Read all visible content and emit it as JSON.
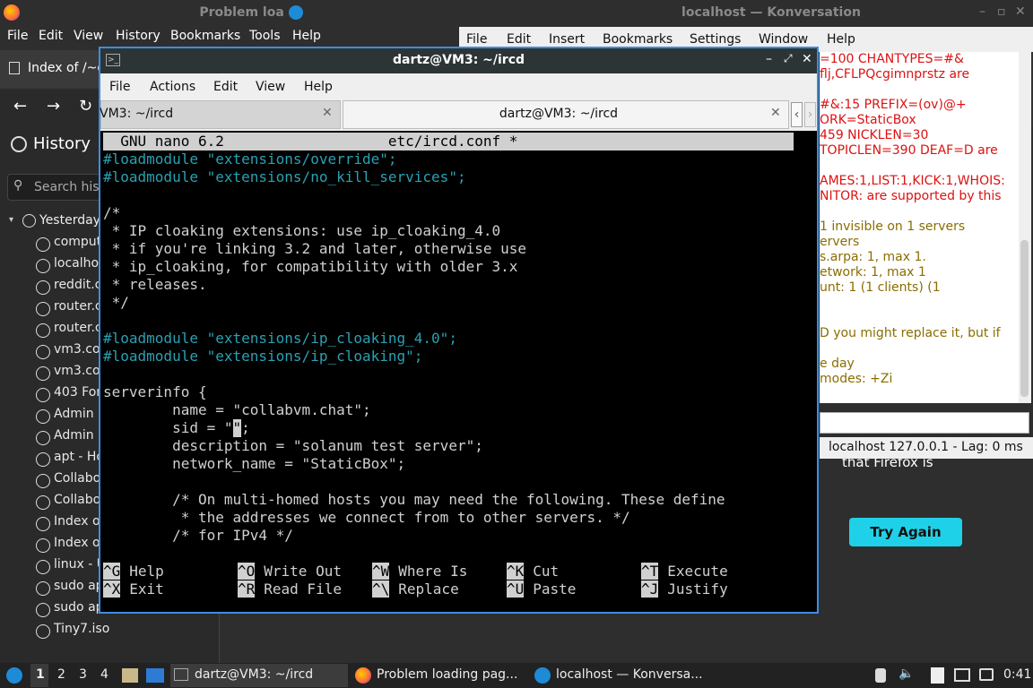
{
  "firefox": {
    "title": "Problem loa",
    "menu": [
      "File",
      "Edit",
      "View",
      "History",
      "Bookmarks",
      "Tools",
      "Help"
    ],
    "tab_label": "Index of /~d",
    "history_title": "History",
    "search_placeholder": "Search hist",
    "history_group": "Yesterday",
    "history_items": [
      "comput",
      "localhos",
      "reddit.c",
      "router.c",
      "router.c",
      "vm3.co",
      "vm3.co",
      "403 For",
      "Admin P",
      "Admin P",
      "apt - Ho",
      "Collabo",
      "Collabo",
      "Index of",
      "Index of",
      "linux - U",
      "sudo ap",
      "sudo ap",
      "Tiny7.iso"
    ],
    "content_text": "that Firefox is",
    "try_again": "Try Again"
  },
  "konversation": {
    "title": "localhost — Konversation",
    "menu": [
      "File",
      "Edit",
      "Insert",
      "Bookmarks",
      "Settings",
      "Window",
      "Help"
    ],
    "lines": [
      {
        "text": "=100 CHANTYPES=#&",
        "color": "#d11"
      },
      {
        "text": "flj,CFLPQcgimnprstz are",
        "color": "#d11"
      },
      {
        "text": "",
        "color": "#d11"
      },
      {
        "text": "#&:15 PREFIX=(ov)@+",
        "color": "#d11"
      },
      {
        "text": "ORK=StaticBox",
        "color": "#d11"
      },
      {
        "text": " 459 NICKLEN=30",
        "color": "#d11"
      },
      {
        "text": "TOPICLEN=390 DEAF=D are",
        "color": "#d11"
      },
      {
        "text": "",
        "color": "#d11"
      },
      {
        "text": "AMES:1,LIST:1,KICK:1,WHOIS:",
        "color": "#d11"
      },
      {
        "text": "NITOR: are supported by this",
        "color": "#d11"
      },
      {
        "text": "",
        "color": "#d11"
      },
      {
        "text": "1 invisible on 1 servers",
        "color": "#8a6d00"
      },
      {
        "text": "ervers",
        "color": "#8a6d00"
      },
      {
        "text": "s.arpa: 1, max 1.",
        "color": "#8a6d00"
      },
      {
        "text": "etwork: 1, max 1",
        "color": "#8a6d00"
      },
      {
        "text": "unt: 1 (1 clients) (1",
        "color": "#8a6d00"
      },
      {
        "text": "",
        "color": "#8a6d00"
      },
      {
        "text": "",
        "color": "#8a6d00"
      },
      {
        "text": "D you might replace it, but if",
        "color": "#8a6d00"
      },
      {
        "text": "",
        "color": "#8a6d00"
      },
      {
        "text": "e day",
        "color": "#8a6d00"
      },
      {
        "text": " modes: +Zi",
        "color": "#8a6d00"
      }
    ],
    "status": "localhost  127.0.0.1 - Lag: 0 ms"
  },
  "terminal": {
    "title": "dartz@VM3: ~/ircd",
    "menu": [
      "File",
      "Actions",
      "Edit",
      "View",
      "Help"
    ],
    "tab1": "VM3: ~/ircd",
    "tab2": "dartz@VM3: ~/ircd",
    "nano_header": "  GNU nano 6.2                   etc/ircd.conf *",
    "lines": [
      {
        "text": "#loadmodule \"extensions/override\";",
        "cls": "cm"
      },
      {
        "text": "#loadmodule \"extensions/no_kill_services\";",
        "cls": "cm"
      },
      {
        "text": "",
        "cls": "wt"
      },
      {
        "text": "/*",
        "cls": "wt"
      },
      {
        "text": " * IP cloaking extensions: use ip_cloaking_4.0",
        "cls": "wt"
      },
      {
        "text": " * if you're linking 3.2 and later, otherwise use",
        "cls": "wt"
      },
      {
        "text": " * ip_cloaking, for compatibility with older 3.x",
        "cls": "wt"
      },
      {
        "text": " * releases.",
        "cls": "wt"
      },
      {
        "text": " */",
        "cls": "wt"
      },
      {
        "text": "",
        "cls": "wt"
      },
      {
        "text": "#loadmodule \"extensions/ip_cloaking_4.0\";",
        "cls": "cm"
      },
      {
        "text": "#loadmodule \"extensions/ip_cloaking\";",
        "cls": "cm"
      },
      {
        "text": "",
        "cls": "wt"
      },
      {
        "text": "serverinfo {",
        "cls": "wt"
      },
      {
        "text": "        name = \"collabvm.chat\";",
        "cls": "wt"
      },
      {
        "text": "        sid = \"",
        "cls": "wt",
        "cursor": "\"",
        "after": ";"
      },
      {
        "text": "        description = \"solanum test server\";",
        "cls": "wt"
      },
      {
        "text": "        network_name = \"StaticBox\";",
        "cls": "wt"
      },
      {
        "text": "",
        "cls": "wt"
      },
      {
        "text": "        /* On multi-homed hosts you may need the following. These define",
        "cls": "wt"
      },
      {
        "text": "         * the addresses we connect from to other servers. */",
        "cls": "wt"
      },
      {
        "text": "        /* for IPv4 */",
        "cls": "wt"
      }
    ],
    "shortcuts_row1": [
      [
        "^G",
        "Help"
      ],
      [
        "^O",
        "Write Out"
      ],
      [
        "^W",
        "Where Is"
      ],
      [
        "^K",
        "Cut"
      ],
      [
        "^T",
        "Execute"
      ]
    ],
    "shortcuts_row2": [
      [
        "^X",
        "Exit"
      ],
      [
        "^R",
        "Read File"
      ],
      [
        "^\\",
        "Replace"
      ],
      [
        "^U",
        "Paste"
      ],
      [
        "^J",
        "Justify"
      ]
    ]
  },
  "taskbar": {
    "workspaces": [
      "1",
      "2",
      "3",
      "4"
    ],
    "tasks": [
      "dartz@VM3: ~/ircd",
      "Problem loading pag...",
      "localhost — Konversa..."
    ],
    "clock": "0:41"
  }
}
